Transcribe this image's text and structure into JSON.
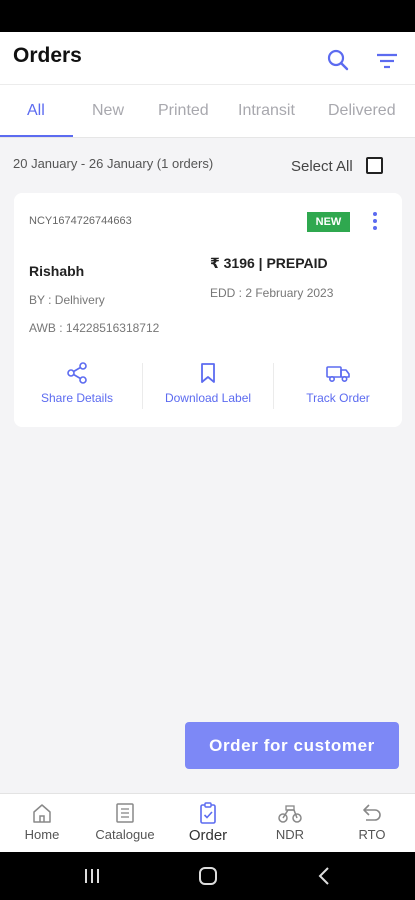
{
  "header": {
    "title": "Orders",
    "search_icon": "search-icon",
    "filter_icon": "filter-icon"
  },
  "tabs": [
    {
      "label": "All",
      "active": true
    },
    {
      "label": "New",
      "active": false
    },
    {
      "label": "Printed",
      "active": false
    },
    {
      "label": "Intransit",
      "active": false
    },
    {
      "label": "Delivered",
      "active": false
    }
  ],
  "list": {
    "date_range": "20 January - 26 January (1 orders)",
    "select_all_label": "Select All",
    "select_all_checked": false
  },
  "order": {
    "id": "NCY1674726744663",
    "status_badge": "NEW",
    "customer_name": "Rishabh",
    "amount": "₹ 3196 | PREPAID",
    "courier": "BY : Delhivery",
    "edd": "EDD : 2 February 2023",
    "awb": "AWB : 14228516318712",
    "actions": {
      "share": "Share Details",
      "download": "Download Label",
      "track": "Track Order"
    }
  },
  "fab": {
    "label": "Order for customer"
  },
  "bottom_nav": [
    {
      "label": "Home",
      "icon": "home-icon"
    },
    {
      "label": "Catalogue",
      "icon": "catalogue-icon"
    },
    {
      "label": "Order",
      "icon": "order-icon",
      "active": true
    },
    {
      "label": "NDR",
      "icon": "ndr-icon"
    },
    {
      "label": "RTO",
      "icon": "rto-icon"
    }
  ],
  "colors": {
    "accent": "#5c6bf0",
    "badge_green": "#2fa84f",
    "fab": "#7d88f6"
  }
}
